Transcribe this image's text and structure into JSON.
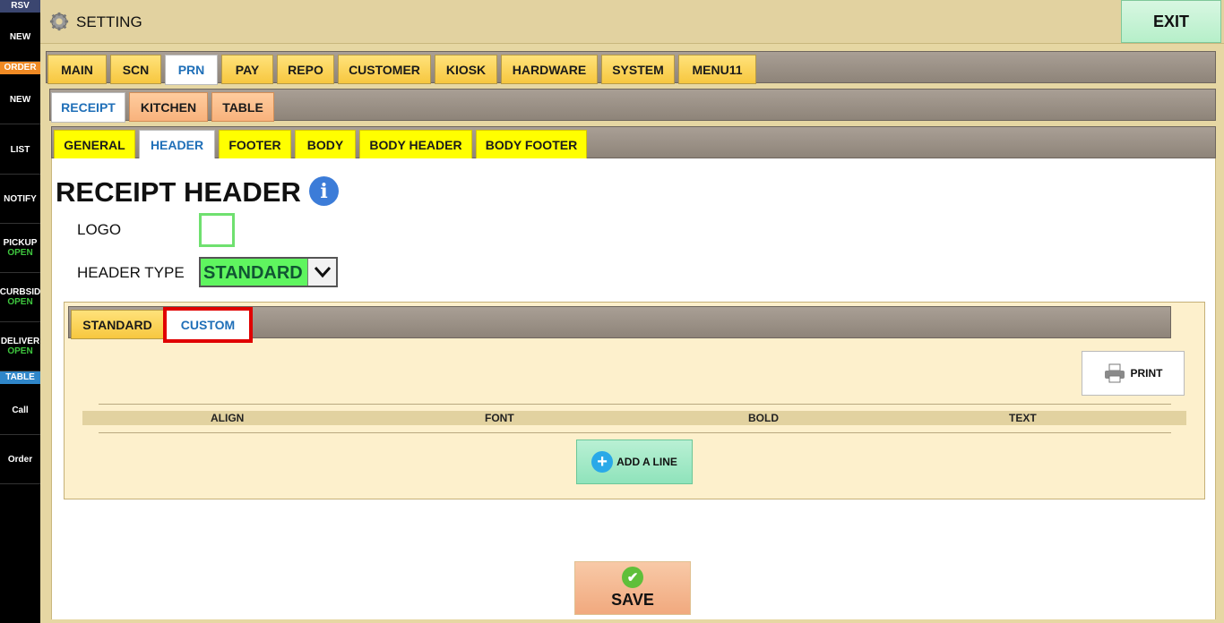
{
  "sidebar": {
    "rsv_header": "RSV",
    "rsv_new": "NEW",
    "order_header": "ORDER",
    "order_new": "NEW",
    "list": "LIST",
    "notify": "NOTIFY",
    "pickup": "PICKUP",
    "pickup_status": "OPEN",
    "curbside": "CURBSID",
    "curbside_status": "OPEN",
    "delivery": "DELIVER",
    "delivery_status": "OPEN",
    "table_header": "TABLE",
    "call": "Call",
    "order": "Order",
    "colors": {
      "rsv": "#3b4670",
      "order": "#f08a24",
      "table": "#2f86c9",
      "open": "#3ec63e"
    }
  },
  "topbar": {
    "title": "SETTING",
    "exit_label": "EXIT"
  },
  "main_tabs": [
    "MAIN",
    "SCN",
    "PRN",
    "PAY",
    "REPO",
    "CUSTOMER",
    "KIOSK",
    "HARDWARE",
    "SYSTEM",
    "MENU11"
  ],
  "main_tabs_selected": "PRN",
  "prn_tabs": [
    "RECEIPT",
    "KITCHEN",
    "TABLE"
  ],
  "prn_tabs_selected": "RECEIPT",
  "receipt_tabs": [
    "GENERAL",
    "HEADER",
    "FOOTER",
    "BODY",
    "BODY HEADER",
    "BODY FOOTER"
  ],
  "receipt_tabs_selected": "HEADER",
  "page": {
    "heading": "RECEIPT HEADER",
    "info_icon": "i",
    "logo_label": "LOGO",
    "header_type_label": "HEADER TYPE",
    "header_type_value": "STANDARD"
  },
  "header_type_tabs": [
    "STANDARD",
    "CUSTOM"
  ],
  "header_type_tabs_selected": "CUSTOM",
  "custom": {
    "print_label": "PRINT",
    "columns": [
      "ALIGN",
      "FONT",
      "BOLD",
      "TEXT"
    ],
    "add_line_label": "ADD A LINE"
  },
  "save_label": "SAVE"
}
